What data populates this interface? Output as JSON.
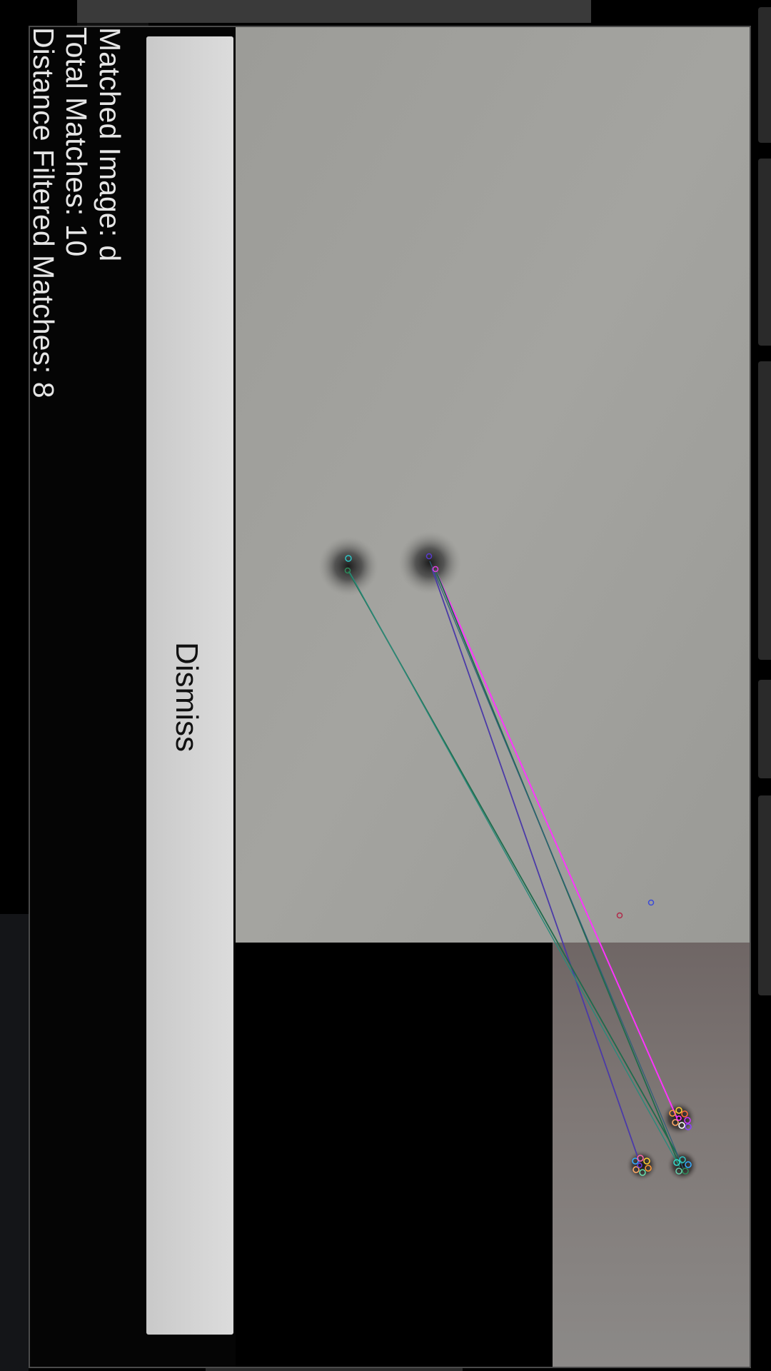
{
  "dialog": {
    "matched_image_text": "Matched Image: d",
    "total_matches_text": "Total Matches: 10",
    "filtered_matches_text": "Distance Filtered Matches: 8",
    "dismiss_label": "Dismiss"
  },
  "match_view": {
    "colors": {
      "query_background": "#a2a29d",
      "reference_background": "#7d7673",
      "empty_area": "#000000",
      "match_line_magenta": "#ff33ff",
      "match_line_green": "#1f7a5a",
      "match_line_purple": "#4b3aa8",
      "match_line_teal": "#2a8a7a"
    }
  }
}
